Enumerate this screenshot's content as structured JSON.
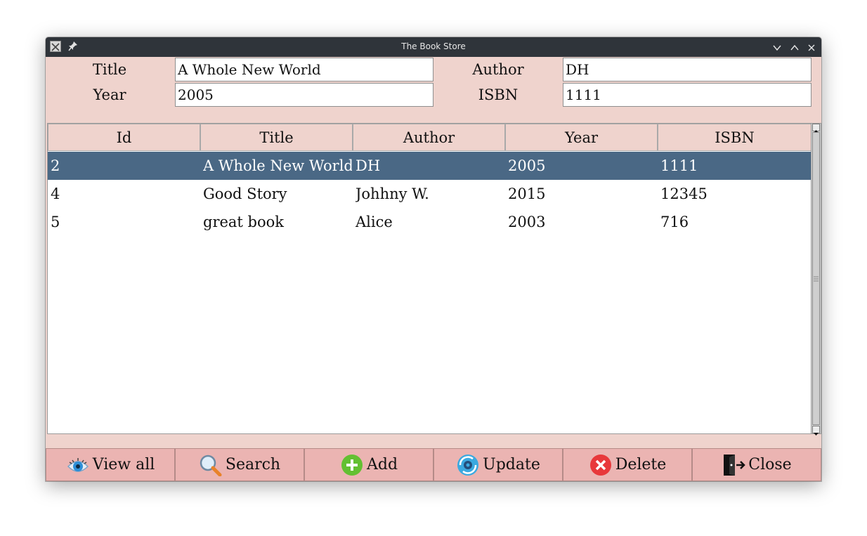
{
  "window": {
    "title": "The Book Store"
  },
  "form": {
    "title_label": "Title",
    "title_value": "A Whole New World",
    "author_label": "Author",
    "author_value": "DH",
    "year_label": "Year",
    "year_value": "2005",
    "isbn_label": "ISBN",
    "isbn_value": "1111"
  },
  "table": {
    "columns": [
      "Id",
      "Title",
      "Author",
      "Year",
      "ISBN"
    ],
    "rows": [
      {
        "id": "2",
        "title": "A Whole New World",
        "author": "DH",
        "year": "2005",
        "isbn": "1111",
        "selected": true
      },
      {
        "id": "4",
        "title": "Good Story",
        "author": "Johhny W.",
        "year": "2015",
        "isbn": "12345",
        "selected": false
      },
      {
        "id": "5",
        "title": "great book",
        "author": "Alice",
        "year": "2003",
        "isbn": "716",
        "selected": false
      }
    ]
  },
  "buttons": {
    "view_all": "View all",
    "search": "Search",
    "add": "Add",
    "update": "Update",
    "delete": "Delete",
    "close": "Close"
  },
  "icons": {
    "view_all": "eye-icon",
    "search": "magnifier-icon",
    "add": "plus-circle-icon",
    "update": "gear-refresh-icon",
    "delete": "x-circle-icon",
    "close": "door-exit-icon"
  },
  "colors": {
    "window_bg": "#efd3cd",
    "button_bg": "#ebb4b2",
    "selected_row": "#4a6885",
    "titlebar": "#2f343a"
  }
}
